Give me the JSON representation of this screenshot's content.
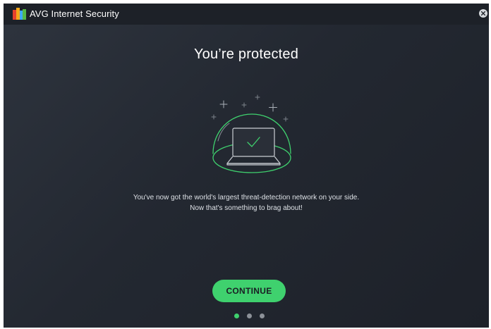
{
  "window": {
    "title": "AVG Internet Security"
  },
  "main": {
    "headline": "You’re protected",
    "message_line1": "You've now got the world's largest threat-detection network on your side.",
    "message_line2": "Now that's something to brag about!",
    "continue_label": "CONTINUE"
  },
  "pagination": {
    "total": 3,
    "current": 1
  },
  "icons": {
    "close": "close-icon",
    "logo": "avg-logo-icon",
    "illustration": "protected-laptop-icon"
  },
  "colors": {
    "accent_green": "#3fd16e",
    "background": "#232831",
    "titlebar": "#1d2128",
    "inactive_dot": "#8c9198"
  }
}
